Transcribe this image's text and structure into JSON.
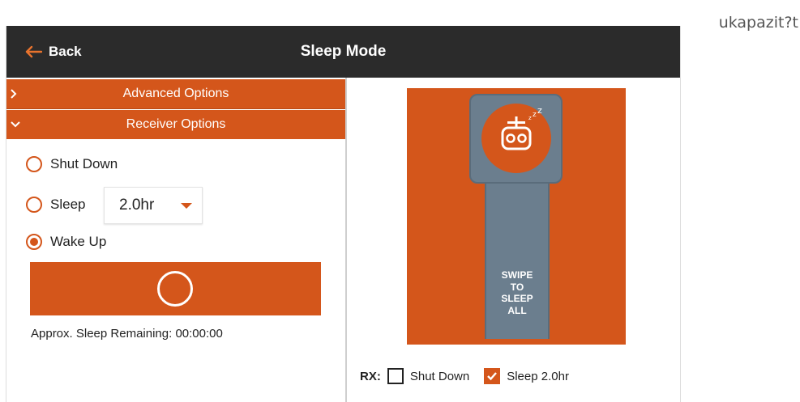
{
  "corner_text": "ukapazit?t",
  "header": {
    "back_label": "Back",
    "title": "Sleep Mode"
  },
  "accordion": {
    "advanced": "Advanced Options",
    "receiver": "Receiver Options"
  },
  "options": {
    "shut_down": "Shut Down",
    "sleep": "Sleep",
    "sleep_duration": "2.0hr",
    "wake_up": "Wake Up",
    "selected": "Wake Up"
  },
  "remaining": {
    "label": "Approx. Sleep Remaining:",
    "value": "00:00:00"
  },
  "slider": {
    "lines": [
      "SWIPE",
      "TO",
      "SLEEP",
      "ALL"
    ]
  },
  "rx": {
    "label": "RX:",
    "items": [
      {
        "label": "Shut Down",
        "checked": false
      },
      {
        "label": "Sleep 2.0hr",
        "checked": true
      }
    ]
  },
  "colors": {
    "accent": "#d4561b",
    "header_bg": "#2b2b2b",
    "slider": "#6b7e8e"
  },
  "icons": [
    "arrow-left-icon",
    "chevron-right-icon",
    "chevron-down-icon",
    "remote-sleep-icon",
    "checkmark-icon"
  ]
}
